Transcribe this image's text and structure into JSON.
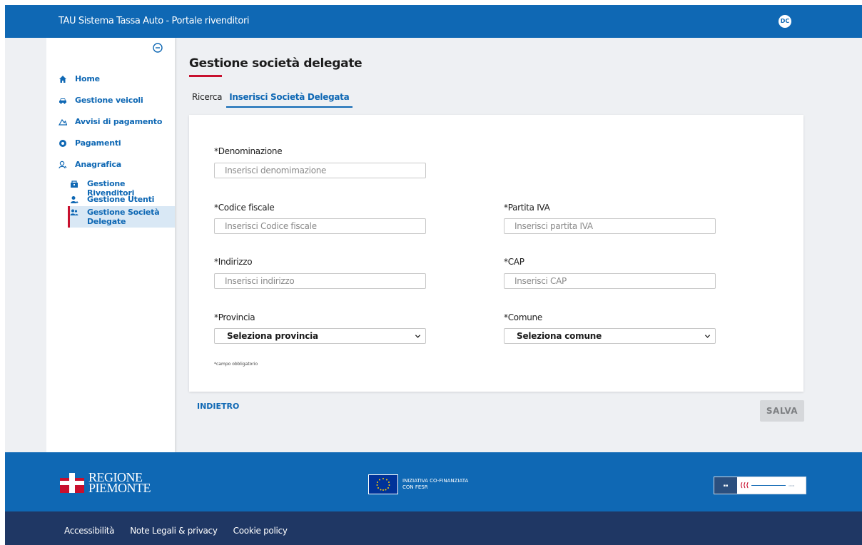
{
  "header": {
    "app_title": "TAU Sistema Tassa Auto - Portale rivenditori",
    "avatar_initials": "DC"
  },
  "sidebar": {
    "items": [
      {
        "label": "Home",
        "icon": "home-icon"
      },
      {
        "label": "Gestione veicoli",
        "icon": "car-icon"
      },
      {
        "label": "Avvisi di pagamento",
        "icon": "mountain-icon"
      },
      {
        "label": "Pagamenti",
        "icon": "payment-icon"
      },
      {
        "label": "Anagrafica",
        "icon": "user-icon"
      }
    ],
    "sub_items": [
      {
        "label": "Gestione Rivenditori",
        "icon": "shop-icon"
      },
      {
        "label": "Gestione Utenti",
        "icon": "user-add-icon"
      },
      {
        "label": "Gestione Società Delegate",
        "icon": "users-group-icon",
        "active": true
      }
    ]
  },
  "page": {
    "title": "Gestione società delegate",
    "tabs": [
      {
        "label": "Ricerca",
        "active": false
      },
      {
        "label": "Inserisci Società Delegata",
        "active": true
      }
    ]
  },
  "form": {
    "denominazione": {
      "label": "*Denominazione",
      "placeholder": "Inserisci denomimazione"
    },
    "codice_fiscale": {
      "label": "*Codice fiscale",
      "placeholder": "Inserisci Codice fiscale"
    },
    "partita_iva": {
      "label": "*Partita IVA",
      "placeholder": "Inserisci partita IVA"
    },
    "indirizzo": {
      "label": "*Indirizzo",
      "placeholder": "Inserisci indirizzo"
    },
    "cap": {
      "label": "*CAP",
      "placeholder": "Inserisci CAP"
    },
    "provincia": {
      "label": "*Provincia",
      "selected": "Seleziona provincia"
    },
    "comune": {
      "label": "*Comune",
      "selected": "Seleziona comune"
    },
    "required_note": "*campo obbligatorio"
  },
  "actions": {
    "back_label": "INDIETRO",
    "save_label": "SALVA"
  },
  "footer": {
    "region_line1": "REGIONE",
    "region_line2": "PIEMONTE",
    "eu_line1": "INIZIATIVA CO-FINANZIATA",
    "eu_line2": "CON FESR",
    "links": [
      "Accessibilità",
      "Note Legali & privacy",
      "Cookie policy"
    ]
  },
  "colors": {
    "primary": "#0f68b4",
    "accent_red": "#c8102e",
    "footer_dark": "#1f3764",
    "background": "#eef0f3"
  }
}
